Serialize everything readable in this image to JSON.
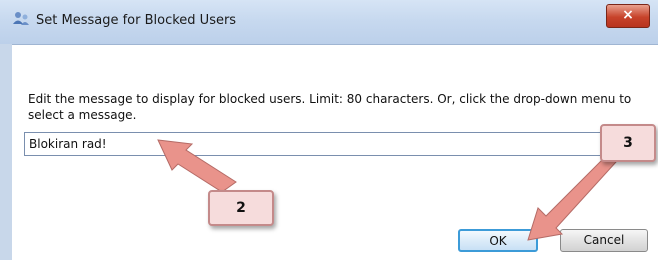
{
  "window": {
    "title": "Set Message for Blocked Users",
    "close_label": "×"
  },
  "dialog": {
    "instruction": "Edit the message to display for blocked users. Limit: 80 characters. Or, click the drop-down menu to select a message.",
    "message_value": "Blokiran rad!",
    "ok_label": "OK",
    "cancel_label": "Cancel"
  },
  "annotations": {
    "callout_2": "2",
    "callout_3": "3",
    "arrow_color": "#d9807a"
  }
}
